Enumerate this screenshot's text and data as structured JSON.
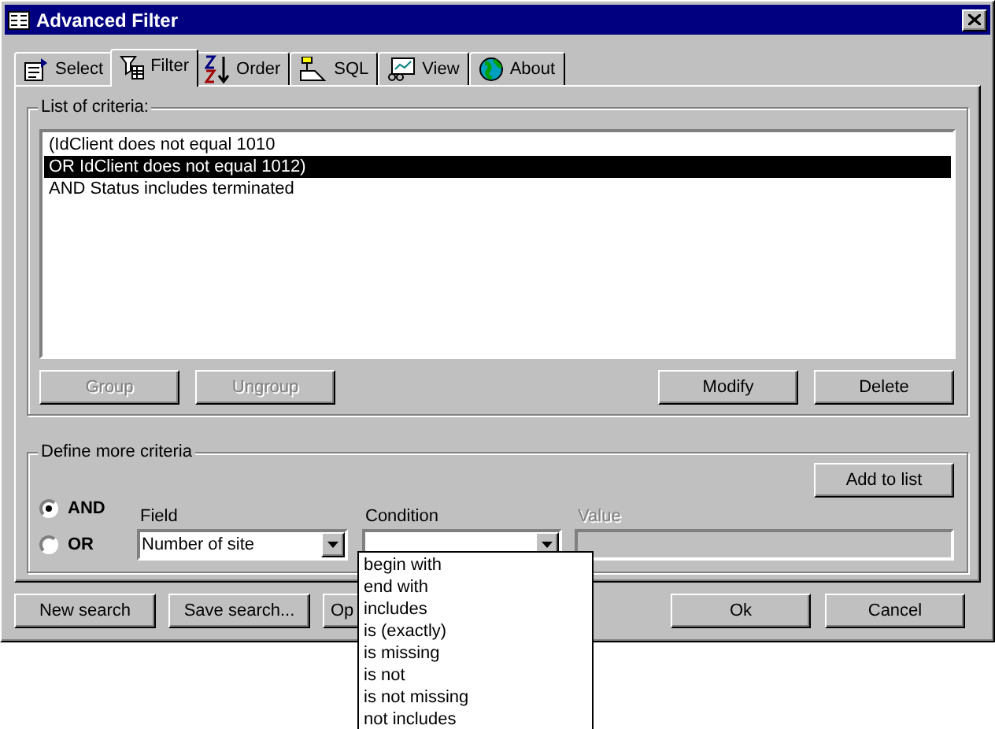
{
  "window": {
    "title": "Advanced Filter"
  },
  "tabs": [
    {
      "label": "Select",
      "selected": false
    },
    {
      "label": "Filter",
      "selected": true
    },
    {
      "label": "Order",
      "selected": false
    },
    {
      "label": "SQL",
      "selected": false
    },
    {
      "label": "View",
      "selected": false
    },
    {
      "label": "About",
      "selected": false
    }
  ],
  "criteria_group": {
    "title": "List of criteria:",
    "items": [
      {
        "text": "(IdClient does not equal 1010",
        "selected": false
      },
      {
        "text": "OR IdClient does not equal 1012)",
        "selected": true
      },
      {
        "text": "AND Status includes terminated",
        "selected": false
      }
    ],
    "buttons": [
      {
        "label": "Group",
        "disabled": true
      },
      {
        "label": "Ungroup",
        "disabled": true
      },
      {
        "label": "Modify",
        "disabled": false
      },
      {
        "label": "Delete",
        "disabled": false
      }
    ]
  },
  "define_group": {
    "title": "Define more criteria",
    "add_button": {
      "label": "Add to list"
    },
    "operators": [
      {
        "label": "AND",
        "selected": true
      },
      {
        "label": "OR",
        "selected": false
      }
    ],
    "field": {
      "label": "Field",
      "value": "Number of site"
    },
    "condition": {
      "label": "Condition",
      "expanded": true,
      "options": [
        "begin with",
        "end with",
        "includes",
        "is (exactly)",
        "is missing",
        "is not",
        "is not missing",
        "not includes"
      ]
    },
    "value": {
      "label": "Value",
      "disabled": true
    }
  },
  "footer": {
    "left_buttons": [
      {
        "label": "New search"
      },
      {
        "label": "Save search..."
      },
      {
        "label": "Op",
        "covered": true
      }
    ],
    "right_buttons": [
      {
        "label": "Ok"
      },
      {
        "label": "Cancel"
      }
    ]
  }
}
